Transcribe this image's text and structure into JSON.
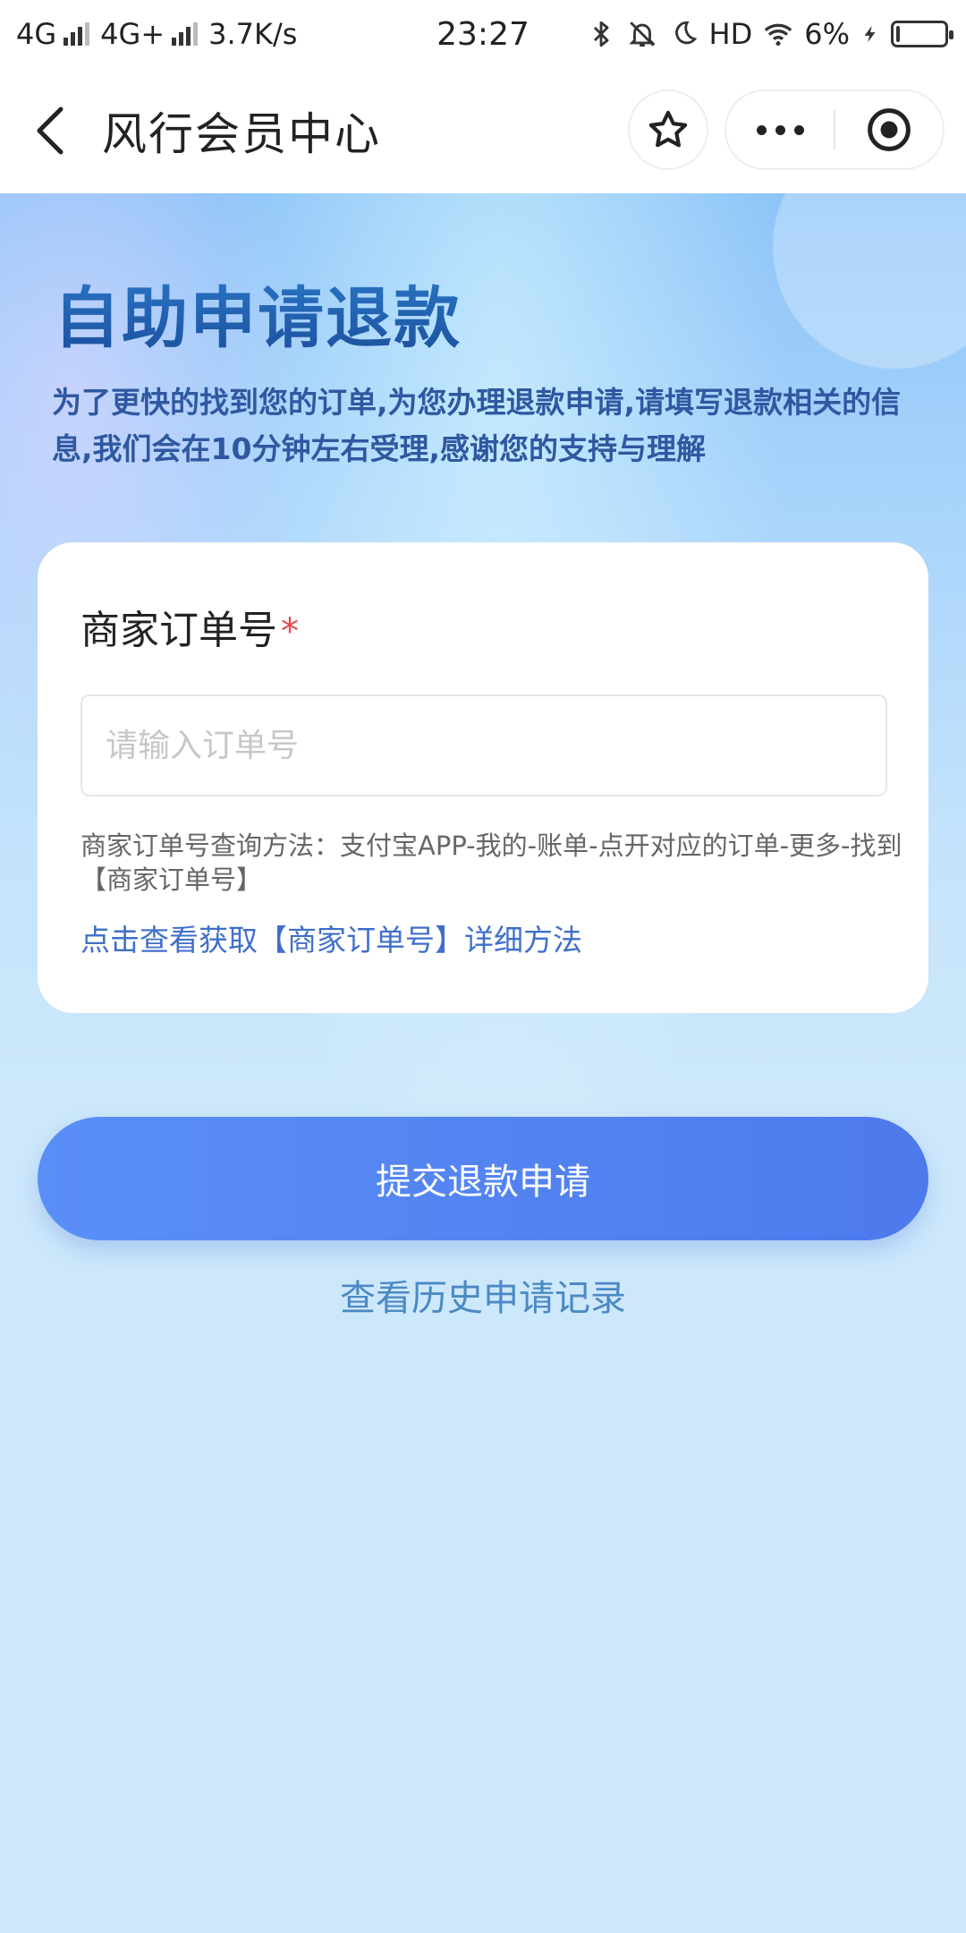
{
  "status_bar": {
    "network_1": "4G",
    "network_2": "4G+",
    "speed": "3.7K/s",
    "time": "23:27",
    "hd": "HD",
    "battery_percent": "6%",
    "battery_level": 0.06
  },
  "nav": {
    "title": "风行会员中心"
  },
  "hero": {
    "title": "自助申请退款",
    "description": "为了更快的找到您的订单,为您办理退款申请,请填写退款相关的信息,我们会在10分钟左右受理,感谢您的支持与理解"
  },
  "form": {
    "order_label": "商家订单号",
    "required_mark": "*",
    "order_input": {
      "value": "",
      "placeholder": "请输入订单号"
    },
    "hint": "商家订单号查询方法：支付宝APP-我的-账单-点开对应的订单-更多-找到【商家订单号】",
    "detail_link": "点击查看获取【商家订单号】详细方法"
  },
  "actions": {
    "submit": "提交退款申请",
    "history": "查看历史申请记录"
  },
  "colors": {
    "primary": "#4d79ec",
    "link": "#3f6fc9",
    "title": "#1b4f9c",
    "required": "#e8474f"
  }
}
